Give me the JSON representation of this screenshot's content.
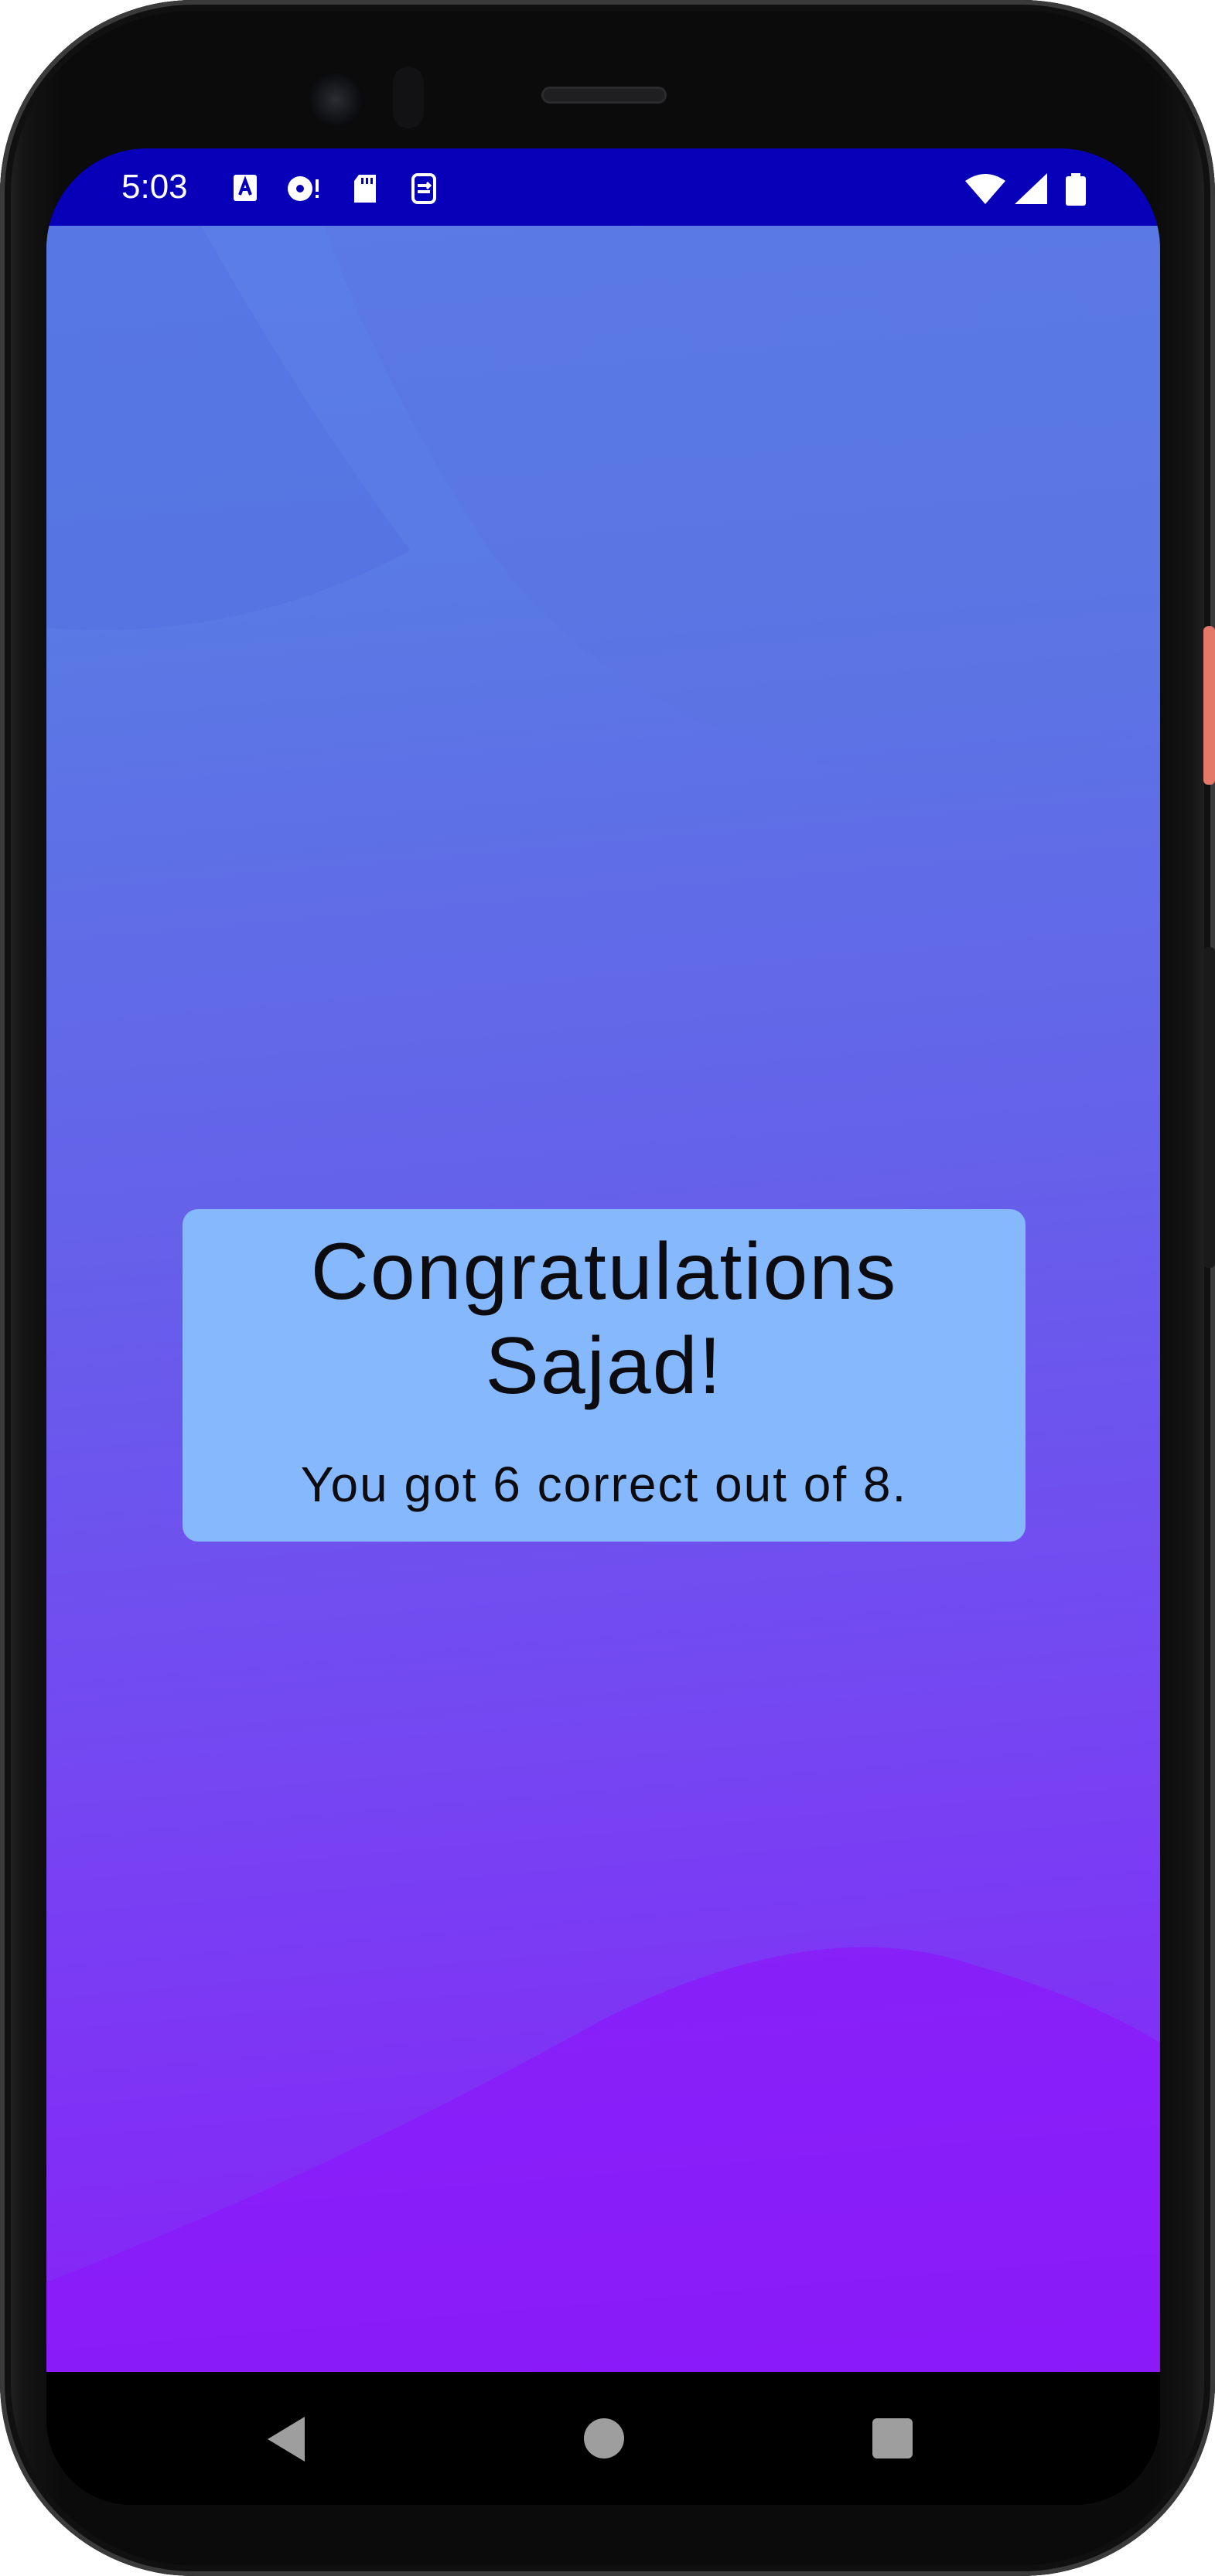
{
  "status_bar": {
    "time": "5:03",
    "background_color": "#0700b8",
    "left_icons": [
      "accessibility-a-icon",
      "media-disc-icon",
      "sd-card-icon",
      "sync-icon"
    ],
    "right_icons": [
      "wifi-icon",
      "cellular-signal-icon",
      "battery-icon"
    ]
  },
  "result": {
    "title_line1": "Congratulations",
    "title_line2": "Sajad!",
    "score_text": "You got 6 correct out of 8.",
    "card_color": "#86b8fd"
  },
  "navigation": {
    "buttons": [
      "back-icon",
      "home-icon",
      "recents-icon"
    ]
  },
  "colors": {
    "gradient_top": "#5b7ee6",
    "gradient_bottom": "#8a1cf8"
  }
}
